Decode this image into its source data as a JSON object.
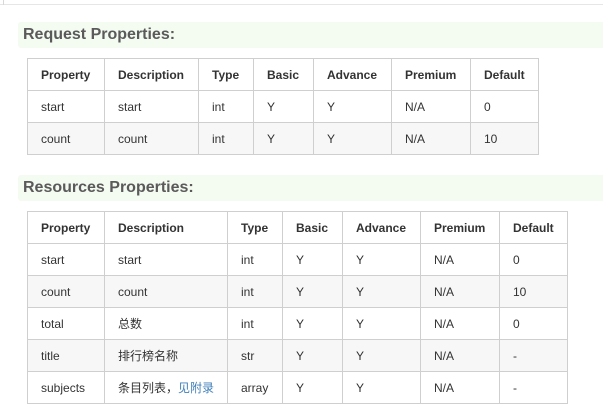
{
  "request": {
    "title": "Request Properties:",
    "headers": [
      "Property",
      "Description",
      "Type",
      "Basic",
      "Advance",
      "Premium",
      "Default"
    ],
    "rows": [
      [
        "start",
        "start",
        "int",
        "Y",
        "Y",
        "N/A",
        "0"
      ],
      [
        "count",
        "count",
        "int",
        "Y",
        "Y",
        "N/A",
        "10"
      ]
    ]
  },
  "resources": {
    "title": "Resources Properties:",
    "headers": [
      "Property",
      "Description",
      "Type",
      "Basic",
      "Advance",
      "Premium",
      "Default"
    ],
    "rows": [
      [
        "start",
        "start",
        "int",
        "Y",
        "Y",
        "N/A",
        "0"
      ],
      [
        "count",
        "count",
        "int",
        "Y",
        "Y",
        "N/A",
        "10"
      ],
      [
        "total",
        "总数",
        "int",
        "Y",
        "Y",
        "N/A",
        "0"
      ],
      [
        "title",
        "排行榜名称",
        "str",
        "Y",
        "Y",
        "N/A",
        "-"
      ],
      [
        "subjects",
        "条目列表，",
        "array",
        "Y",
        "Y",
        "N/A",
        "-"
      ]
    ],
    "subjects_link": "见附录"
  }
}
